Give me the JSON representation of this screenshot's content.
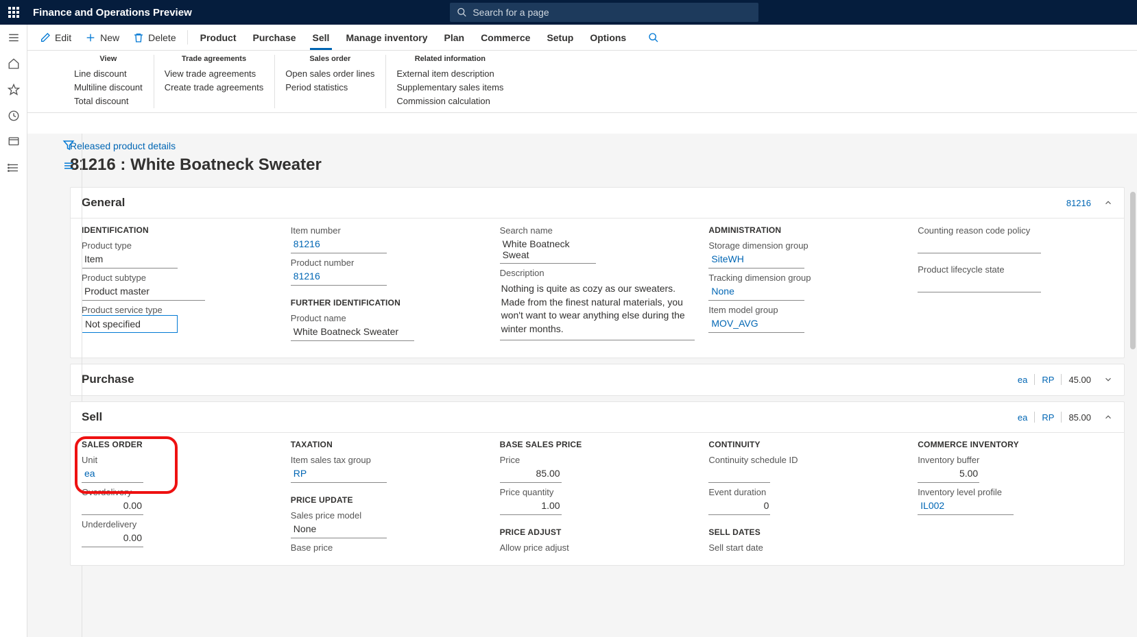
{
  "app_title": "Finance and Operations Preview",
  "search_placeholder": "Search for a page",
  "cmd": {
    "edit": "Edit",
    "new": "New",
    "delete": "Delete",
    "tabs": [
      "Product",
      "Purchase",
      "Sell",
      "Manage inventory",
      "Plan",
      "Commerce",
      "Setup",
      "Options"
    ],
    "active_tab": "Sell"
  },
  "ribbon": {
    "groups": [
      {
        "title": "View",
        "items": [
          "Line discount",
          "Multiline discount",
          "Total discount"
        ]
      },
      {
        "title": "Trade agreements",
        "items": [
          "View trade agreements",
          "Create trade agreements"
        ]
      },
      {
        "title": "Sales order",
        "items": [
          "Open sales order lines",
          "Period statistics"
        ]
      },
      {
        "title": "Related information",
        "items": [
          "External item description",
          "Supplementary sales items",
          "Commission calculation"
        ]
      }
    ]
  },
  "breadcrumb": "Released product details",
  "page_title": "81216 : White Boatneck Sweater",
  "general": {
    "title": "General",
    "header_tag": "81216",
    "identification": {
      "h": "IDENTIFICATION",
      "product_type_l": "Product type",
      "product_type": "Item",
      "product_subtype_l": "Product subtype",
      "product_subtype": "Product master",
      "product_service_type_l": "Product service type",
      "product_service_type": "Not specified"
    },
    "item_number_l": "Item number",
    "item_number": "81216",
    "product_number_l": "Product number",
    "product_number": "81216",
    "further_h": "FURTHER IDENTIFICATION",
    "product_name_l": "Product name",
    "product_name": "White Boatneck Sweater",
    "search_name_l": "Search name",
    "search_name": "White Boatneck Sweat",
    "description_l": "Description",
    "description": "Nothing is quite as cozy as our sweaters. Made from the finest natural materials, you won't want to wear anything else during the winter months.",
    "administration_h": "ADMINISTRATION",
    "storage_dim_l": "Storage dimension group",
    "storage_dim": "SiteWH",
    "tracking_dim_l": "Tracking dimension group",
    "tracking_dim": "None",
    "item_model_l": "Item model group",
    "item_model": "MOV_AVG",
    "counting_reason_l": "Counting reason code policy",
    "lifecycle_l": "Product lifecycle state"
  },
  "purchase": {
    "title": "Purchase",
    "unit": "ea",
    "group": "RP",
    "price": "45.00"
  },
  "sell": {
    "title": "Sell",
    "hdr_unit": "ea",
    "hdr_group": "RP",
    "hdr_price": "85.00",
    "sales_order_h": "SALES ORDER",
    "unit_l": "Unit",
    "unit": "ea",
    "overdelivery_l": "Overdelivery",
    "overdelivery": "0.00",
    "underdelivery_l": "Underdelivery",
    "underdelivery": "0.00",
    "taxation_h": "TAXATION",
    "item_sales_tax_l": "Item sales tax group",
    "item_sales_tax": "RP",
    "price_update_h": "PRICE UPDATE",
    "sales_price_model_l": "Sales price model",
    "sales_price_model": "None",
    "base_price_l": "Base price",
    "base_sales_price_h": "BASE SALES PRICE",
    "price_l": "Price",
    "price": "85.00",
    "price_qty_l": "Price quantity",
    "price_qty": "1.00",
    "price_adjust_h": "PRICE ADJUST",
    "allow_price_adjust_l": "Allow price adjust",
    "continuity_h": "CONTINUITY",
    "continuity_sched_l": "Continuity schedule ID",
    "event_duration_l": "Event duration",
    "event_duration": "0",
    "sell_dates_h": "SELL DATES",
    "sell_start_l": "Sell start date",
    "commerce_inv_h": "COMMERCE INVENTORY",
    "inv_buffer_l": "Inventory buffer",
    "inv_buffer": "5.00",
    "inv_level_l": "Inventory level profile",
    "inv_level": "IL002"
  }
}
